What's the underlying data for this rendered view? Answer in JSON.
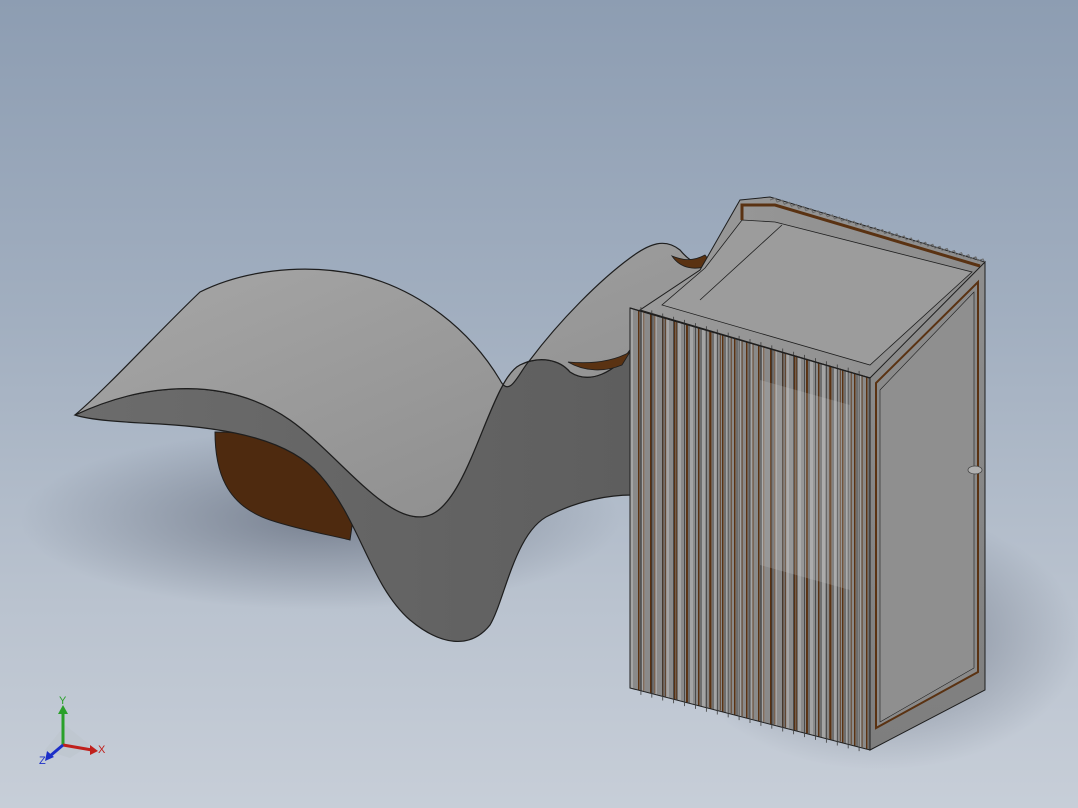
{
  "viewport": {
    "background_top": "#8d9db2",
    "background_bottom": "#c7ced8",
    "model_face_color": "#8c8c8c",
    "model_edge_color": "#1e1e1e",
    "model_inner_color": "#5a3212"
  },
  "triad": {
    "x_label": "X",
    "y_label": "Y",
    "z_label": "Z",
    "x_color": "#c0201c",
    "y_color": "#2aa02a",
    "z_color": "#1c2fc8"
  }
}
